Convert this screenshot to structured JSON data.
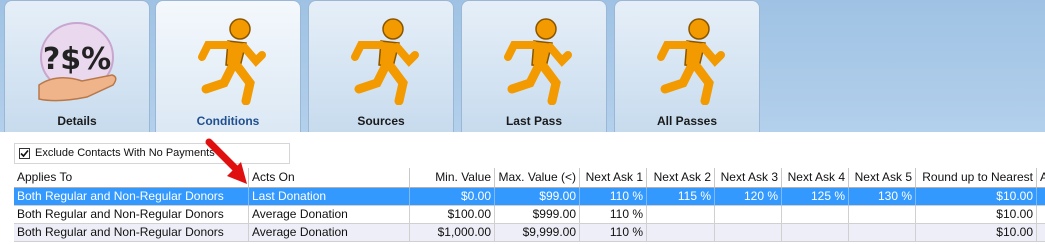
{
  "tabs": [
    {
      "label": "Details",
      "icon": "money-hand-icon"
    },
    {
      "label": "Conditions",
      "icon": "running-man-icon",
      "active": true
    },
    {
      "label": "Sources",
      "icon": "running-man-icon"
    },
    {
      "label": "Last Pass",
      "icon": "running-man-icon"
    },
    {
      "label": "All Passes",
      "icon": "running-man-icon"
    }
  ],
  "details_icon_text": "?$%",
  "filter": {
    "label": "Exclude Contacts With No Payments",
    "checked": true
  },
  "grid": {
    "columns": [
      "Applies To",
      "Acts On",
      "Min. Value",
      "Max. Value (<)",
      "Next Ask 1",
      "Next Ask 2",
      "Next Ask 3",
      "Next Ask 4",
      "Next Ask 5",
      "Round up to Nearest",
      "A"
    ],
    "rows": [
      [
        "Both Regular and Non-Regular Donors",
        "Last Donation",
        "$0.00",
        "$99.00",
        "110 %",
        "115 %",
        "120 %",
        "125 %",
        "130 %",
        "$10.00",
        ""
      ],
      [
        "Both Regular and Non-Regular Donors",
        "Average Donation",
        "$100.00",
        "$999.00",
        "110 %",
        "",
        "",
        "",
        "",
        "$10.00",
        ""
      ],
      [
        "Both Regular and Non-Regular Donors",
        "Average Donation",
        "$1,000.00",
        "$9,999.00",
        "110 %",
        "",
        "",
        "",
        "",
        "$10.00",
        ""
      ]
    ],
    "selected_row": 0
  },
  "colors": {
    "selection": "#3399ff",
    "arrow": "#e01010",
    "runner": "#f29a00"
  }
}
